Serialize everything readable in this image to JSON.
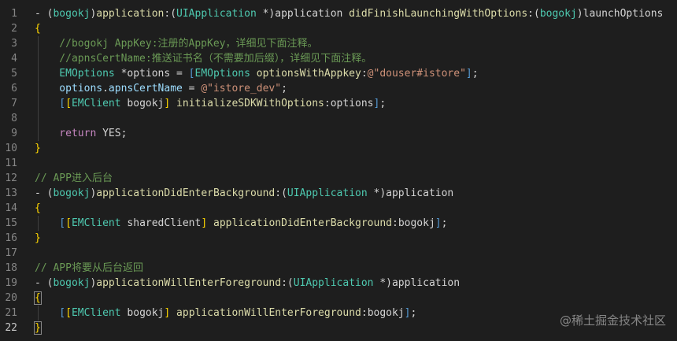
{
  "editor": {
    "lines": [
      {
        "n": "1",
        "tokens": [
          {
            "t": "- ",
            "c": "punc"
          },
          {
            "t": "(",
            "c": "punc"
          },
          {
            "t": "bogokj",
            "c": "type"
          },
          {
            "t": ")",
            "c": "punc"
          },
          {
            "t": "application",
            "c": "method"
          },
          {
            "t": ":",
            "c": "punc"
          },
          {
            "t": "(",
            "c": "punc"
          },
          {
            "t": "UIApplication",
            "c": "type"
          },
          {
            "t": " *)",
            "c": "punc"
          },
          {
            "t": "application",
            "c": "param"
          },
          {
            "t": " didFinishLaunchingWithOptions",
            "c": "method"
          },
          {
            "t": ":",
            "c": "punc"
          },
          {
            "t": "(",
            "c": "punc"
          },
          {
            "t": "bogokj",
            "c": "type"
          },
          {
            "t": ")",
            "c": "punc"
          },
          {
            "t": "launchOptions",
            "c": "param"
          }
        ]
      },
      {
        "n": "2",
        "tokens": [
          {
            "t": "{",
            "c": "brace"
          }
        ]
      },
      {
        "n": "3",
        "tokens": [
          {
            "t": "    //bogokj AppKey:注册的AppKey，详细见下面注释。",
            "c": "comment"
          }
        ]
      },
      {
        "n": "4",
        "tokens": [
          {
            "t": "    //apnsCertName:推送证书名（不需要加后缀），详细见下面注释。",
            "c": "comment"
          }
        ]
      },
      {
        "n": "5",
        "tokens": [
          {
            "t": "    EMOptions ",
            "c": "type"
          },
          {
            "t": "*options = ",
            "c": "punc"
          },
          {
            "t": "[",
            "c": "bracket"
          },
          {
            "t": "EMOptions",
            "c": "type"
          },
          {
            "t": " optionsWithAppkey",
            "c": "method"
          },
          {
            "t": ":",
            "c": "punc"
          },
          {
            "t": "@\"douser#istore\"",
            "c": "str"
          },
          {
            "t": "]",
            "c": "bracket"
          },
          {
            "t": ";",
            "c": "punc"
          }
        ]
      },
      {
        "n": "6",
        "tokens": [
          {
            "t": "    options",
            "c": "var"
          },
          {
            "t": ".",
            "c": "punc"
          },
          {
            "t": "apnsCertName",
            "c": "var"
          },
          {
            "t": " = ",
            "c": "punc"
          },
          {
            "t": "@\"istore_dev\"",
            "c": "str"
          },
          {
            "t": ";",
            "c": "punc"
          }
        ]
      },
      {
        "n": "7",
        "tokens": [
          {
            "t": "    [",
            "c": "bracket"
          },
          {
            "t": "[",
            "c": "brace"
          },
          {
            "t": "EMClient",
            "c": "type"
          },
          {
            "t": " bogokj",
            "c": "param"
          },
          {
            "t": "]",
            "c": "brace"
          },
          {
            "t": " initializeSDKWithOptions",
            "c": "method"
          },
          {
            "t": ":",
            "c": "punc"
          },
          {
            "t": "options",
            "c": "param"
          },
          {
            "t": "]",
            "c": "bracket"
          },
          {
            "t": ";",
            "c": "punc"
          }
        ]
      },
      {
        "n": "8",
        "tokens": []
      },
      {
        "n": "9",
        "tokens": [
          {
            "t": "    return",
            "c": "kw"
          },
          {
            "t": " YES;",
            "c": "punc"
          }
        ]
      },
      {
        "n": "10",
        "tokens": [
          {
            "t": "}",
            "c": "brace"
          }
        ]
      },
      {
        "n": "11",
        "tokens": []
      },
      {
        "n": "12",
        "tokens": [
          {
            "t": "// APP进入后台",
            "c": "comment"
          }
        ]
      },
      {
        "n": "13",
        "tokens": [
          {
            "t": "- ",
            "c": "punc"
          },
          {
            "t": "(",
            "c": "punc"
          },
          {
            "t": "bogokj",
            "c": "type"
          },
          {
            "t": ")",
            "c": "punc"
          },
          {
            "t": "applicationDidEnterBackground",
            "c": "method"
          },
          {
            "t": ":",
            "c": "punc"
          },
          {
            "t": "(",
            "c": "punc"
          },
          {
            "t": "UIApplication",
            "c": "type"
          },
          {
            "t": " *)",
            "c": "punc"
          },
          {
            "t": "application",
            "c": "param"
          }
        ]
      },
      {
        "n": "14",
        "tokens": [
          {
            "t": "{",
            "c": "brace"
          }
        ]
      },
      {
        "n": "15",
        "tokens": [
          {
            "t": "    [",
            "c": "bracket"
          },
          {
            "t": "[",
            "c": "brace"
          },
          {
            "t": "EMClient",
            "c": "type"
          },
          {
            "t": " sharedClient",
            "c": "param"
          },
          {
            "t": "]",
            "c": "brace"
          },
          {
            "t": " applicationDidEnterBackground",
            "c": "method"
          },
          {
            "t": ":",
            "c": "punc"
          },
          {
            "t": "bogokj",
            "c": "param"
          },
          {
            "t": "]",
            "c": "bracket"
          },
          {
            "t": ";",
            "c": "punc"
          }
        ]
      },
      {
        "n": "16",
        "tokens": [
          {
            "t": "}",
            "c": "brace"
          }
        ]
      },
      {
        "n": "17",
        "tokens": []
      },
      {
        "n": "18",
        "tokens": [
          {
            "t": "// APP将要从后台返回",
            "c": "comment"
          }
        ]
      },
      {
        "n": "19",
        "tokens": [
          {
            "t": "- ",
            "c": "punc"
          },
          {
            "t": "(",
            "c": "punc"
          },
          {
            "t": "bogokj",
            "c": "type"
          },
          {
            "t": ")",
            "c": "punc"
          },
          {
            "t": "applicationWillEnterForeground",
            "c": "method"
          },
          {
            "t": ":",
            "c": "punc"
          },
          {
            "t": "(",
            "c": "punc"
          },
          {
            "t": "UIApplication",
            "c": "type"
          },
          {
            "t": " *)",
            "c": "punc"
          },
          {
            "t": "application",
            "c": "param"
          }
        ]
      },
      {
        "n": "20",
        "tokens": [
          {
            "t": "{",
            "c": "brace",
            "box": true
          }
        ]
      },
      {
        "n": "21",
        "tokens": [
          {
            "t": "    [",
            "c": "bracket"
          },
          {
            "t": "[",
            "c": "brace"
          },
          {
            "t": "EMClient",
            "c": "type"
          },
          {
            "t": " bogokj",
            "c": "param"
          },
          {
            "t": "]",
            "c": "brace"
          },
          {
            "t": " applicationWillEnterForeground",
            "c": "method"
          },
          {
            "t": ":",
            "c": "punc"
          },
          {
            "t": "bogokj",
            "c": "param"
          },
          {
            "t": "]",
            "c": "bracket"
          },
          {
            "t": ";",
            "c": "punc"
          }
        ]
      },
      {
        "n": "22",
        "active": true,
        "tokens": [
          {
            "t": "}",
            "c": "brace",
            "box": true
          }
        ]
      }
    ]
  },
  "watermark": "@稀土掘金技术社区"
}
